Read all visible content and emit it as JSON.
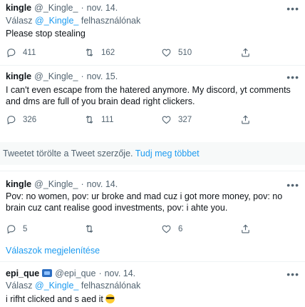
{
  "tweets": [
    {
      "name": "kingle",
      "handle": "@_Kingle_",
      "dot": "·",
      "date": "nov. 14.",
      "reply_prefix": "Válasz",
      "reply_mention": "@_Kingle_",
      "reply_suffix": "felhasználónak",
      "text": "Please stop stealing",
      "replies": "411",
      "retweets": "162",
      "likes": "510"
    },
    {
      "name": "kingle",
      "handle": "@_Kingle_",
      "dot": "·",
      "date": "nov. 15.",
      "text": "I can't even escape from the hatered anymore. My discord, yt comments and dms are full of you brain dead right clickers.",
      "replies": "326",
      "retweets": "111",
      "likes": "327"
    },
    {
      "name": "kingle",
      "handle": "@_Kingle_",
      "dot": "·",
      "date": "nov. 14.",
      "text": "Pov: no women, pov: ur broke and mad cuz i got more money, pov: no brain cuz cant realise good investments, pov: i ahte you.",
      "replies": "5",
      "retweets": "",
      "likes": "6"
    },
    {
      "name": "epi_que",
      "handle": "@epi_que",
      "dot": "·",
      "date": "nov. 14.",
      "reply_prefix": "Válasz",
      "reply_mention": "@_Kingle_",
      "reply_suffix": "felhasználónak",
      "text": "i rifht clicked and s aed it"
    }
  ],
  "deleted_banner": {
    "text": "Tweetet törölte a Tweet szerzője.",
    "link": "Tudj meg többet"
  },
  "show_replies": "Válaszok megjelenítése",
  "more_glyph": "•••",
  "icons": [
    "reply-icon",
    "retweet-icon",
    "like-icon",
    "share-icon",
    "more-icon",
    "tv-emoji-icon",
    "sunglasses-emoji-icon"
  ],
  "colors": {
    "link": "#1d9bf0",
    "muted": "#536471",
    "text": "#0f1419",
    "banner_bg": "#f7f9f9"
  }
}
